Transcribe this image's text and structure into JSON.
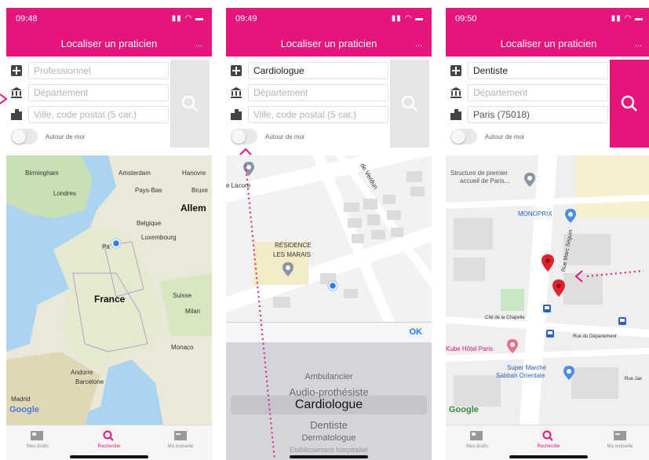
{
  "brand_color": "#e6157c",
  "screens": [
    {
      "time": "09:48",
      "title": "Localiser un praticien",
      "more": "...",
      "fields": {
        "profession": {
          "value": "",
          "placeholder": "Professionnel"
        },
        "departement": {
          "value": "",
          "placeholder": "Département"
        },
        "ville": {
          "value": "",
          "placeholder": "Ville, code postal (5 car.)"
        }
      },
      "around_me": "Autour de moi",
      "map_labels": {
        "birmingham": "Birmingham",
        "amsterdam": "Amsterdam",
        "hanovre": "Hanovre",
        "londres": "Londres",
        "pays_bas": "Pays-Bas",
        "bruxelles": "Bruxe",
        "allemagne": "Allem",
        "belgique": "Belgique",
        "luxembourg": "Luxembourg",
        "paris": "Pa",
        "france": "France",
        "suisse": "Suisse",
        "milan": "Milan",
        "monaco": "Monaco",
        "andorre": "Andorre",
        "barcelone": "Barcelone",
        "madrid": "Madrid"
      },
      "google": "Google"
    },
    {
      "time": "09:49",
      "title": "Localiser un praticien",
      "more": "...",
      "fields": {
        "profession": {
          "value": "Cardiologue",
          "placeholder": "Professionnel"
        },
        "departement": {
          "value": "",
          "placeholder": "Département"
        },
        "ville": {
          "value": "",
          "placeholder": "Ville, code postal (5 car.)"
        }
      },
      "around_me": "Autour de moi",
      "map_labels": {
        "lacore": "e Lacore",
        "residence": "RÉSIDENCE",
        "marais": "LES MARAIS",
        "verdun": "de Verdun"
      },
      "ok": "OK",
      "picker_items": [
        "Ambulancier",
        "Audio-prothésiste",
        "Cardiologue",
        "Dentiste",
        "Dermatologue",
        "Etablissement hospitalier"
      ],
      "picker_selected": "Cardiologue"
    },
    {
      "time": "09:50",
      "title": "Localiser un praticien",
      "more": "...",
      "fields": {
        "profession": {
          "value": "Dentiste",
          "placeholder": "Professionnel"
        },
        "departement": {
          "value": "",
          "placeholder": "Département"
        },
        "ville": {
          "value": "Paris (75018)",
          "placeholder": "Ville, code postal (5 car.)"
        }
      },
      "around_me": "Autour de moi",
      "map_labels": {
        "structure1": "Structure de premier",
        "structure2": "accueil de Paris...",
        "monoprix": "MONOPRIX",
        "rue": "Rue Marc Séguin",
        "chapelle": "Cité de la Chapelle",
        "kube": "Kube Hôtel Paris",
        "supermarche1": "Super Marché",
        "supermarche2": "Sabbah Orientale",
        "departement_rue": "Rue du Département",
        "jax": "Rue Jax"
      },
      "google": "Google"
    }
  ],
  "tabs": [
    {
      "label": "Mes droits"
    },
    {
      "label": "Recherche"
    },
    {
      "label": "Ma mutuelle"
    }
  ]
}
